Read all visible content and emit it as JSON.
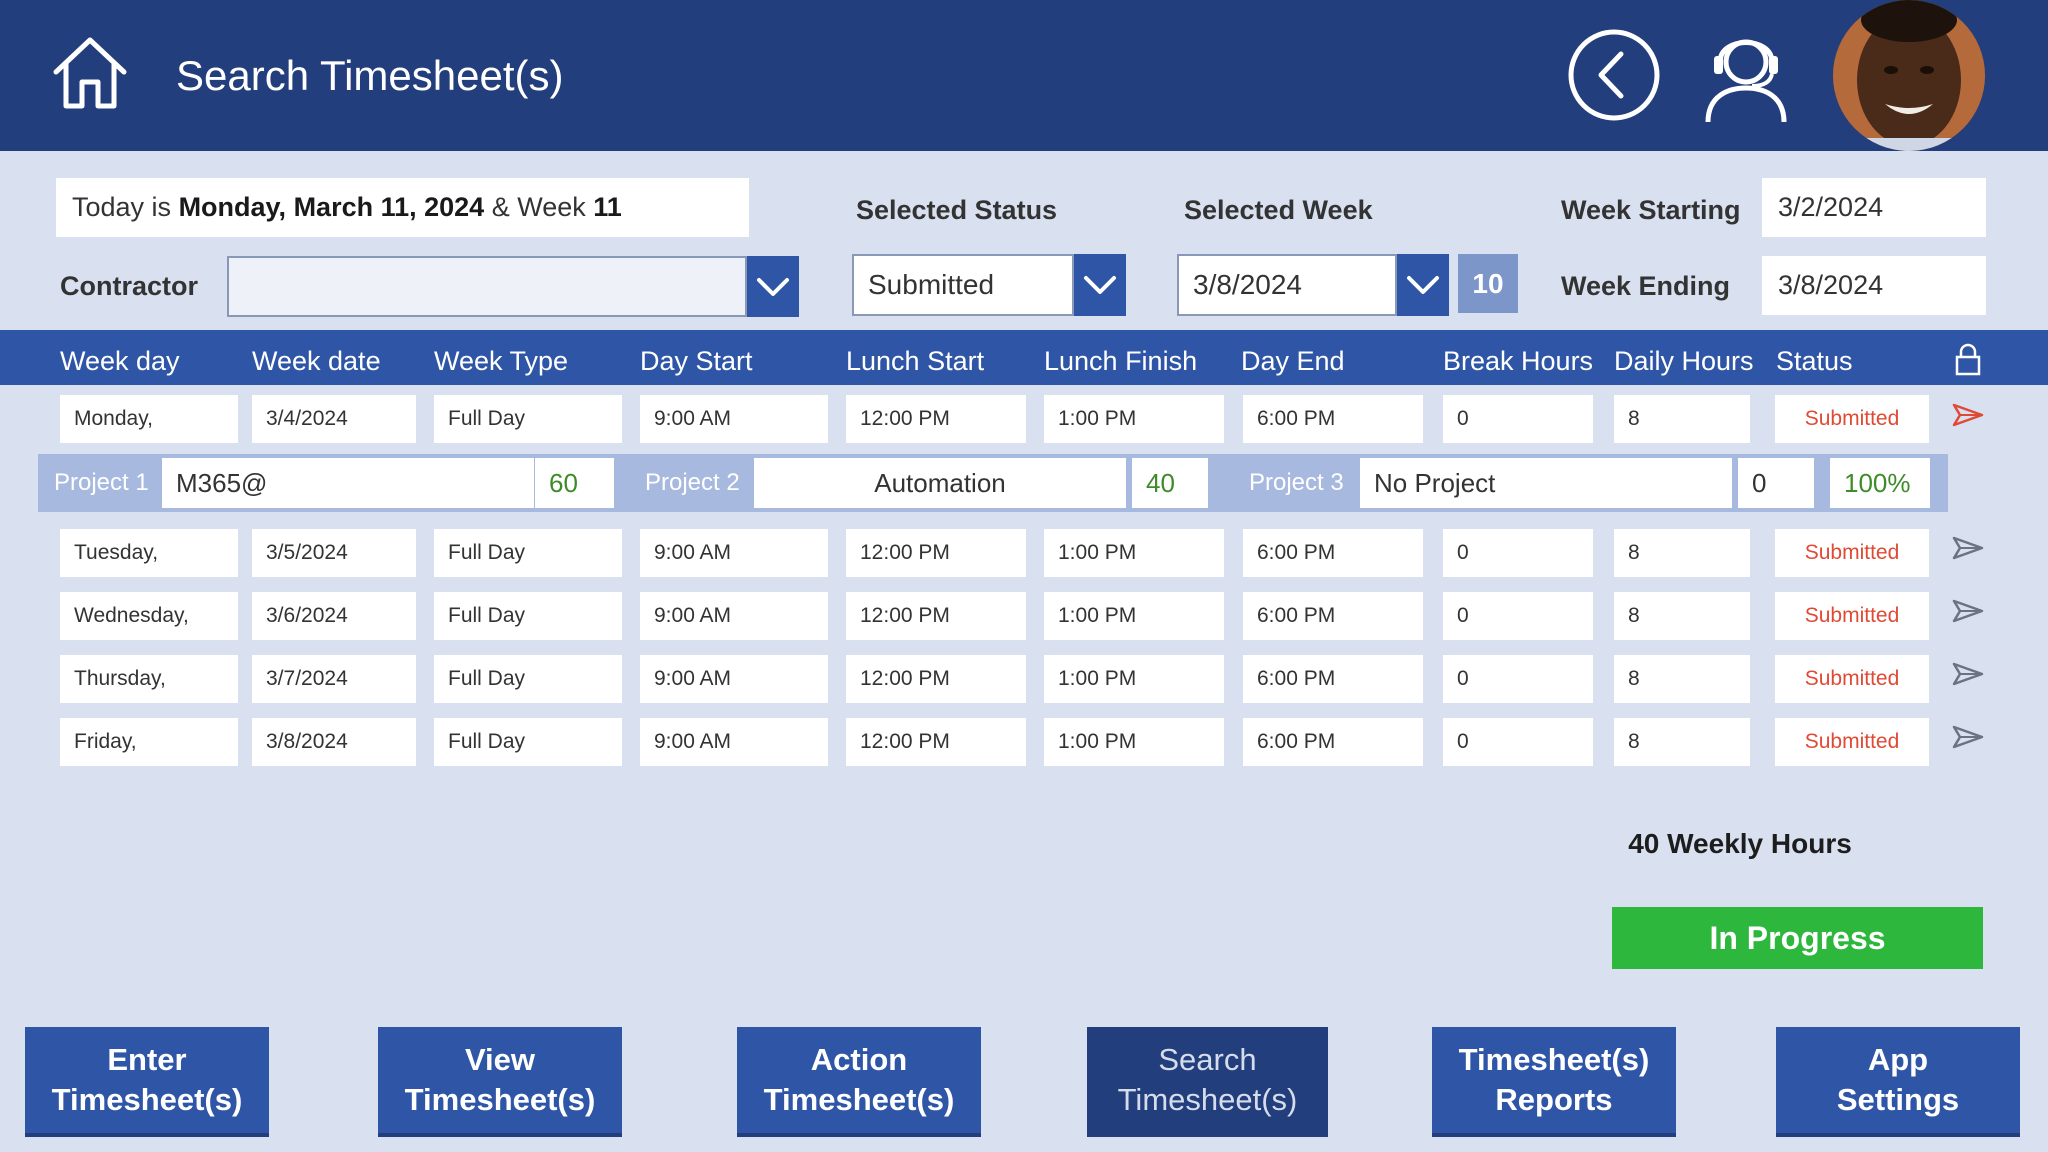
{
  "header": {
    "title": "Search Timesheet(s)",
    "home_icon": "home-icon",
    "back_icon": "back-circle-icon",
    "support_icon": "support-agent-icon"
  },
  "info": {
    "today_prefix": "Today is ",
    "today_date": "Monday, March 11, 2024",
    "today_mid": " & Week ",
    "today_week": "11",
    "contractor_label": "Contractor",
    "contractor_value": "",
    "selected_status_label": "Selected Status",
    "selected_status_value": "Submitted",
    "selected_week_label": "Selected Week",
    "selected_week_value": "3/8/2024",
    "selected_week_number": "10",
    "week_starting_label": "Week Starting",
    "week_starting_value": "3/2/2024",
    "week_ending_label": "Week Ending",
    "week_ending_value": "3/8/2024"
  },
  "table": {
    "headers": [
      "Week day",
      "Week date",
      "Week Type",
      "Day Start",
      "Lunch Start",
      "Lunch Finish",
      "Day End",
      "Break Hours",
      "Daily Hours",
      "Status"
    ],
    "rows": [
      [
        "Monday,",
        "3/4/2024",
        "Full Day",
        "9:00 AM",
        "12:00 PM",
        "1:00 PM",
        "6:00 PM",
        "0",
        "8",
        "Submitted"
      ],
      [
        "Tuesday,",
        "3/5/2024",
        "Full Day",
        "9:00 AM",
        "12:00 PM",
        "1:00 PM",
        "6:00 PM",
        "0",
        "8",
        "Submitted"
      ],
      [
        "Wednesday,",
        "3/6/2024",
        "Full Day",
        "9:00 AM",
        "12:00 PM",
        "1:00 PM",
        "6:00 PM",
        "0",
        "8",
        "Submitted"
      ],
      [
        "Thursday,",
        "3/7/2024",
        "Full Day",
        "9:00 AM",
        "12:00 PM",
        "1:00 PM",
        "6:00 PM",
        "0",
        "8",
        "Submitted"
      ],
      [
        "Friday,",
        "3/8/2024",
        "Full Day",
        "9:00 AM",
        "12:00 PM",
        "1:00 PM",
        "6:00 PM",
        "0",
        "8",
        "Submitted"
      ]
    ]
  },
  "projects": {
    "p1_label": "Project 1",
    "p1_name": "M365@",
    "p1_pct": "60",
    "p2_label": "Project 2",
    "p2_name": "Automation",
    "p2_pct": "40",
    "p3_label": "Project 3",
    "p3_name": "No Project",
    "p3_pct": "0",
    "total": "100%"
  },
  "summary": {
    "weekly_hours": "40 Weekly Hours",
    "status_button": "In Progress"
  },
  "nav": [
    "Enter\nTimesheet(s)",
    "View\nTimesheet(s)",
    "Action\nTimesheet(s)",
    "Search\nTimesheet(s)",
    "Timesheet(s)\nReports",
    "App\nSettings"
  ],
  "colors": {
    "header_bg": "#233e7c",
    "accent": "#2f56a6",
    "page_bg": "#d9e1f1",
    "status_red": "#e04a35",
    "progress_green": "#2db83d"
  }
}
